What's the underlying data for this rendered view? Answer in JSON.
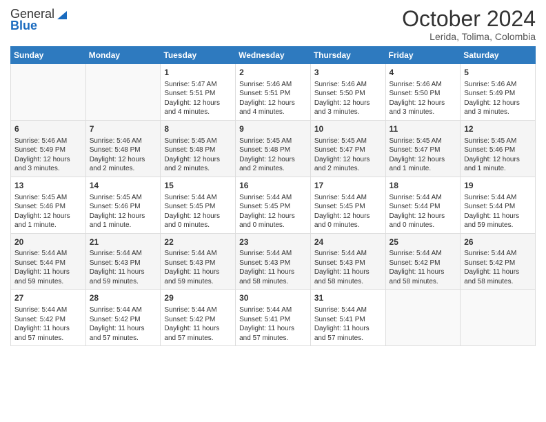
{
  "header": {
    "logo_general": "General",
    "logo_blue": "Blue",
    "month_title": "October 2024",
    "location": "Lerida, Tolima, Colombia"
  },
  "days_of_week": [
    "Sunday",
    "Monday",
    "Tuesday",
    "Wednesday",
    "Thursday",
    "Friday",
    "Saturday"
  ],
  "weeks": [
    [
      {
        "day": "",
        "info": ""
      },
      {
        "day": "",
        "info": ""
      },
      {
        "day": "1",
        "info": "Sunrise: 5:47 AM\nSunset: 5:51 PM\nDaylight: 12 hours and 4 minutes."
      },
      {
        "day": "2",
        "info": "Sunrise: 5:46 AM\nSunset: 5:51 PM\nDaylight: 12 hours and 4 minutes."
      },
      {
        "day": "3",
        "info": "Sunrise: 5:46 AM\nSunset: 5:50 PM\nDaylight: 12 hours and 3 minutes."
      },
      {
        "day": "4",
        "info": "Sunrise: 5:46 AM\nSunset: 5:50 PM\nDaylight: 12 hours and 3 minutes."
      },
      {
        "day": "5",
        "info": "Sunrise: 5:46 AM\nSunset: 5:49 PM\nDaylight: 12 hours and 3 minutes."
      }
    ],
    [
      {
        "day": "6",
        "info": "Sunrise: 5:46 AM\nSunset: 5:49 PM\nDaylight: 12 hours and 3 minutes."
      },
      {
        "day": "7",
        "info": "Sunrise: 5:46 AM\nSunset: 5:48 PM\nDaylight: 12 hours and 2 minutes."
      },
      {
        "day": "8",
        "info": "Sunrise: 5:45 AM\nSunset: 5:48 PM\nDaylight: 12 hours and 2 minutes."
      },
      {
        "day": "9",
        "info": "Sunrise: 5:45 AM\nSunset: 5:48 PM\nDaylight: 12 hours and 2 minutes."
      },
      {
        "day": "10",
        "info": "Sunrise: 5:45 AM\nSunset: 5:47 PM\nDaylight: 12 hours and 2 minutes."
      },
      {
        "day": "11",
        "info": "Sunrise: 5:45 AM\nSunset: 5:47 PM\nDaylight: 12 hours and 1 minute."
      },
      {
        "day": "12",
        "info": "Sunrise: 5:45 AM\nSunset: 5:46 PM\nDaylight: 12 hours and 1 minute."
      }
    ],
    [
      {
        "day": "13",
        "info": "Sunrise: 5:45 AM\nSunset: 5:46 PM\nDaylight: 12 hours and 1 minute."
      },
      {
        "day": "14",
        "info": "Sunrise: 5:45 AM\nSunset: 5:46 PM\nDaylight: 12 hours and 1 minute."
      },
      {
        "day": "15",
        "info": "Sunrise: 5:44 AM\nSunset: 5:45 PM\nDaylight: 12 hours and 0 minutes."
      },
      {
        "day": "16",
        "info": "Sunrise: 5:44 AM\nSunset: 5:45 PM\nDaylight: 12 hours and 0 minutes."
      },
      {
        "day": "17",
        "info": "Sunrise: 5:44 AM\nSunset: 5:45 PM\nDaylight: 12 hours and 0 minutes."
      },
      {
        "day": "18",
        "info": "Sunrise: 5:44 AM\nSunset: 5:44 PM\nDaylight: 12 hours and 0 minutes."
      },
      {
        "day": "19",
        "info": "Sunrise: 5:44 AM\nSunset: 5:44 PM\nDaylight: 11 hours and 59 minutes."
      }
    ],
    [
      {
        "day": "20",
        "info": "Sunrise: 5:44 AM\nSunset: 5:44 PM\nDaylight: 11 hours and 59 minutes."
      },
      {
        "day": "21",
        "info": "Sunrise: 5:44 AM\nSunset: 5:43 PM\nDaylight: 11 hours and 59 minutes."
      },
      {
        "day": "22",
        "info": "Sunrise: 5:44 AM\nSunset: 5:43 PM\nDaylight: 11 hours and 59 minutes."
      },
      {
        "day": "23",
        "info": "Sunrise: 5:44 AM\nSunset: 5:43 PM\nDaylight: 11 hours and 58 minutes."
      },
      {
        "day": "24",
        "info": "Sunrise: 5:44 AM\nSunset: 5:43 PM\nDaylight: 11 hours and 58 minutes."
      },
      {
        "day": "25",
        "info": "Sunrise: 5:44 AM\nSunset: 5:42 PM\nDaylight: 11 hours and 58 minutes."
      },
      {
        "day": "26",
        "info": "Sunrise: 5:44 AM\nSunset: 5:42 PM\nDaylight: 11 hours and 58 minutes."
      }
    ],
    [
      {
        "day": "27",
        "info": "Sunrise: 5:44 AM\nSunset: 5:42 PM\nDaylight: 11 hours and 57 minutes."
      },
      {
        "day": "28",
        "info": "Sunrise: 5:44 AM\nSunset: 5:42 PM\nDaylight: 11 hours and 57 minutes."
      },
      {
        "day": "29",
        "info": "Sunrise: 5:44 AM\nSunset: 5:42 PM\nDaylight: 11 hours and 57 minutes."
      },
      {
        "day": "30",
        "info": "Sunrise: 5:44 AM\nSunset: 5:41 PM\nDaylight: 11 hours and 57 minutes."
      },
      {
        "day": "31",
        "info": "Sunrise: 5:44 AM\nSunset: 5:41 PM\nDaylight: 11 hours and 57 minutes."
      },
      {
        "day": "",
        "info": ""
      },
      {
        "day": "",
        "info": ""
      }
    ]
  ]
}
